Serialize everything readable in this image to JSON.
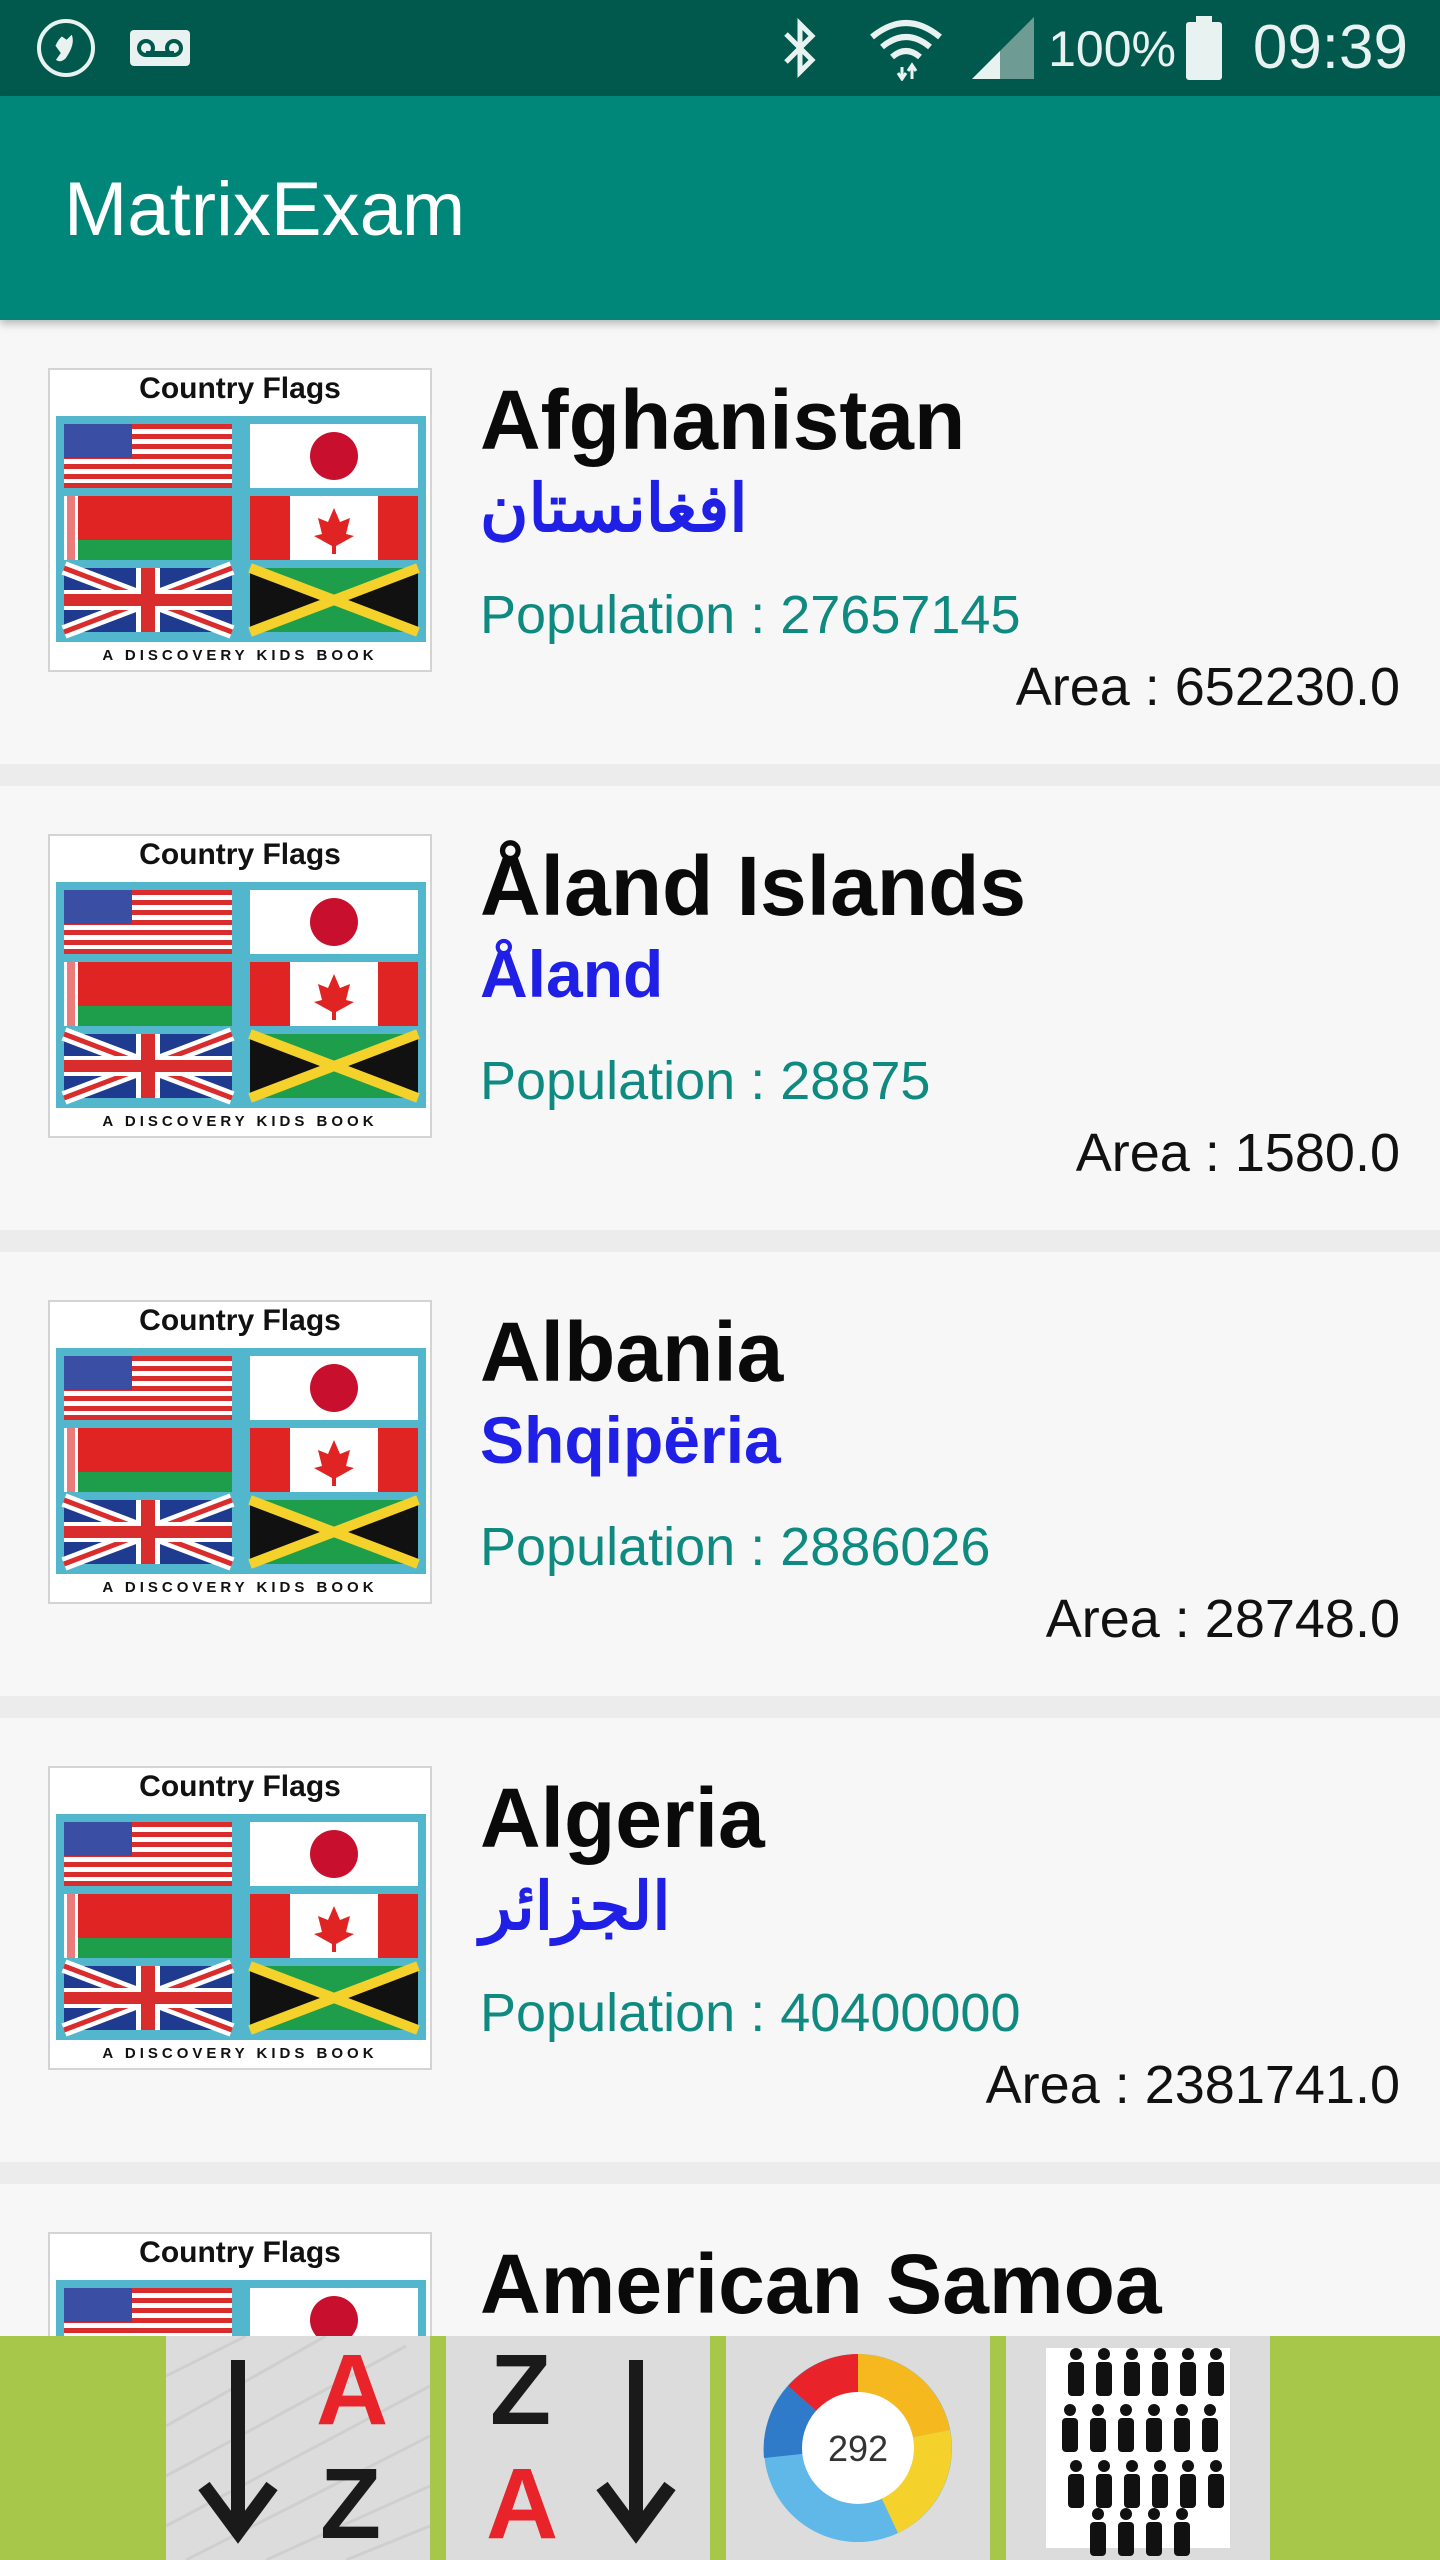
{
  "status_bar": {
    "icons_left": [
      "phone-call-icon",
      "voicemail-icon"
    ],
    "icons_right": [
      "bluetooth-icon",
      "wifi-icon",
      "signal-icon",
      "battery-icon"
    ],
    "battery": "100%",
    "time": "09:39"
  },
  "app_bar": {
    "title": "MatrixExam"
  },
  "thumbnail": {
    "title": "Country Flags",
    "footer": "A DISCOVERY KIDS BOOK"
  },
  "countries": [
    {
      "name": "Afghanistan",
      "native": "افغانستان",
      "population": "Population : 27657145",
      "area": "Area : 652230.0"
    },
    {
      "name": "Åland Islands",
      "native": "Åland",
      "population": "Population : 28875",
      "area": "Area : 1580.0"
    },
    {
      "name": "Albania",
      "native": "Shqipëria",
      "population": "Population : 2886026",
      "area": "Area : 28748.0"
    },
    {
      "name": "Algeria",
      "native": "الجزائر",
      "population": "Population : 40400000",
      "area": "Area : 2381741.0"
    },
    {
      "name": "American Samoa",
      "native": "",
      "population": "",
      "area": ""
    }
  ],
  "bottom_bar": {
    "buttons": [
      {
        "icon": "sort-a-z-icon",
        "label_top": "A",
        "label_bottom": "Z"
      },
      {
        "icon": "sort-z-a-icon",
        "label_top": "Z",
        "label_bottom": "A"
      },
      {
        "icon": "altmetric-badge-icon",
        "label": "292"
      },
      {
        "icon": "population-icon"
      }
    ]
  },
  "colors": {
    "status_bar": "#01594e",
    "app_bar": "#01877a",
    "native_name": "#1f1fe6",
    "population": "#0f8a80",
    "bottom_bar": "#a7c74a"
  }
}
